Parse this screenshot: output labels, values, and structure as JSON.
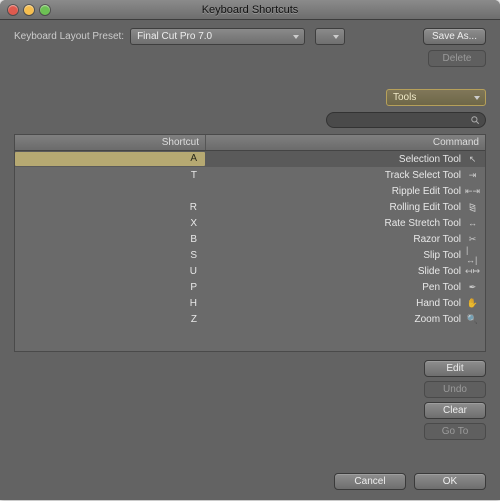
{
  "window": {
    "title": "Keyboard Shortcuts"
  },
  "preset": {
    "label": "Keyboard Layout Preset:",
    "value": "Final Cut Pro 7.0"
  },
  "buttons": {
    "save_as": "Save As...",
    "delete": "Delete",
    "edit": "Edit",
    "undo": "Undo",
    "clear": "Clear",
    "goto": "Go To",
    "cancel": "Cancel",
    "ok": "OK"
  },
  "category": "Tools",
  "table": {
    "headers": {
      "command": "Command",
      "shortcut": "Shortcut"
    },
    "rows": [
      {
        "icon": "cursor",
        "label": "Selection Tool",
        "shortcut": "A",
        "selected": true
      },
      {
        "icon": "track-select",
        "label": "Track Select Tool",
        "shortcut": "T"
      },
      {
        "icon": "ripple",
        "label": "Ripple Edit Tool",
        "shortcut": ""
      },
      {
        "icon": "rolling",
        "label": "Rolling Edit Tool",
        "shortcut": "R"
      },
      {
        "icon": "rate",
        "label": "Rate Stretch Tool",
        "shortcut": "X"
      },
      {
        "icon": "razor",
        "label": "Razor Tool",
        "shortcut": "B"
      },
      {
        "icon": "slip",
        "label": "Slip Tool",
        "shortcut": "S"
      },
      {
        "icon": "slide",
        "label": "Slide Tool",
        "shortcut": "U"
      },
      {
        "icon": "pen",
        "label": "Pen Tool",
        "shortcut": "P"
      },
      {
        "icon": "hand",
        "label": "Hand Tool",
        "shortcut": "H"
      },
      {
        "icon": "zoom",
        "label": "Zoom Tool",
        "shortcut": "Z"
      }
    ]
  }
}
